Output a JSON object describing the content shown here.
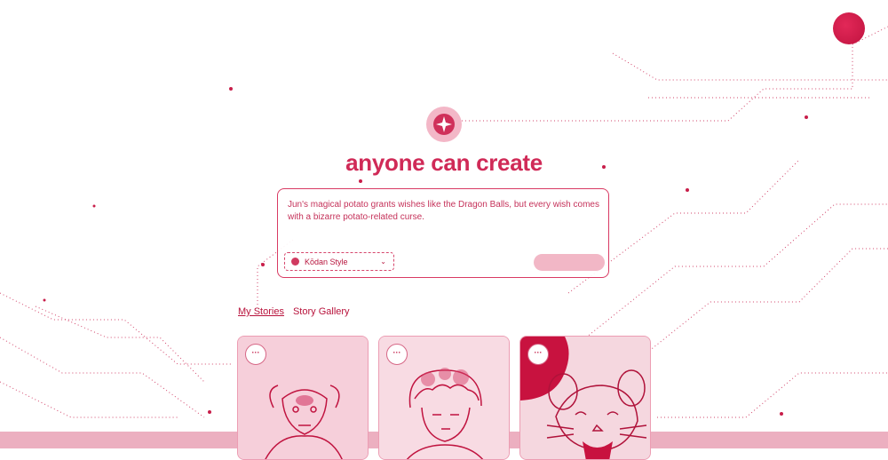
{
  "hero": {
    "title": "anyone can create"
  },
  "prompt": {
    "text": "Jun's magical potato grants wishes like the Dragon Balls, but every wish comes with a bizarre potato-related curse.",
    "style_label": "Kōdan Style",
    "create_label": ""
  },
  "tabs": [
    {
      "label": "My Stories",
      "active": true
    },
    {
      "label": "Story Gallery",
      "active": false
    }
  ],
  "cards": [
    {
      "menu": "···",
      "subject": "bull"
    },
    {
      "menu": "···",
      "subject": "boy"
    },
    {
      "menu": "···",
      "subject": "mouse"
    }
  ],
  "colors": {
    "accent": "#c81e4a",
    "light": "#f2b7c6",
    "background": "#ffffff"
  }
}
